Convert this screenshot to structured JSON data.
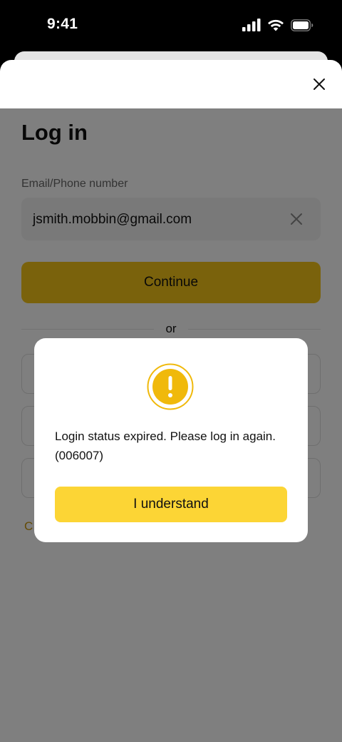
{
  "status_bar": {
    "time": "9:41",
    "icons": [
      "cellular-signal-icon",
      "wifi-icon",
      "battery-icon"
    ]
  },
  "login": {
    "title": "Log in",
    "email_label": "Email/Phone number",
    "email_value": "jsmith.mobbin@gmail.com",
    "continue_label": "Continue",
    "divider_text": "or",
    "create_link_partial": "C"
  },
  "dialog": {
    "message": "Login status expired. Please log in again. (006007)",
    "button_label": "I understand",
    "icon": "warning-icon"
  },
  "colors": {
    "accent": "#f5c518",
    "dialog_button": "#fcd535",
    "warning_icon": "#f0b90b",
    "overlay": "rgba(0,0,0,0.5)"
  }
}
